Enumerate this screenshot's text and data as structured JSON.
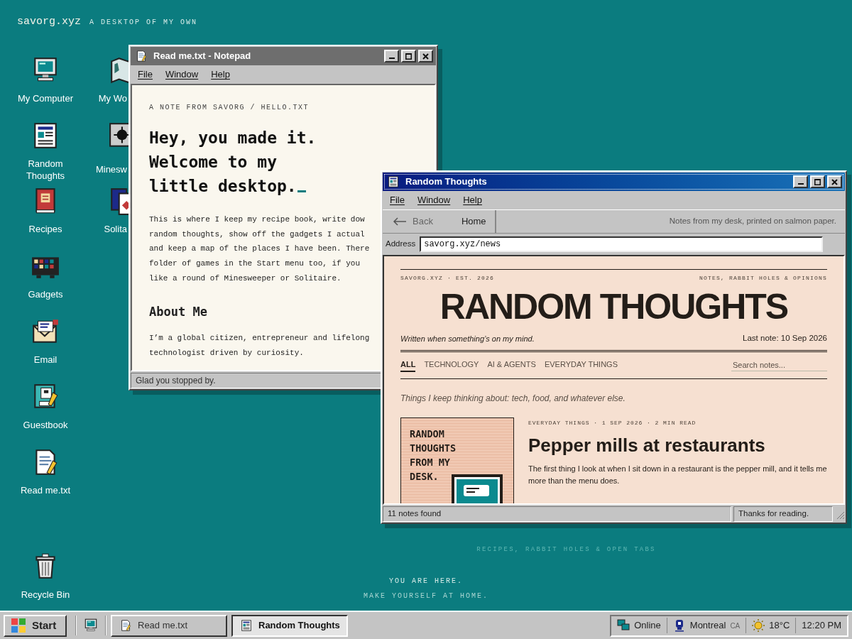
{
  "desktop": {
    "brand": "savorg.xyz",
    "tagline": "A DESKTOP OF MY OWN",
    "icons_column_1": [
      {
        "kind": "computer",
        "label": "My Computer"
      },
      {
        "kind": "newspaper",
        "label": "Random Thoughts"
      },
      {
        "kind": "book",
        "label": "Recipes"
      },
      {
        "kind": "gadgets",
        "label": "Gadgets"
      },
      {
        "kind": "email",
        "label": "Email"
      },
      {
        "kind": "guestbook",
        "label": "Guestbook"
      },
      {
        "kind": "textfile",
        "label": "Read me.txt"
      }
    ],
    "icons_column_2": [
      {
        "kind": "map",
        "label": "My Wo"
      },
      {
        "kind": "mine",
        "label": "Minesw"
      },
      {
        "kind": "cards",
        "label": "Solita"
      }
    ],
    "recycle_bin": {
      "kind": "bin",
      "label": "Recycle Bin"
    },
    "faint_tagline": "RECIPES, RABBIT HOLES & OPEN TABS",
    "footer_lines": [
      "YOU ARE HERE.",
      "MAKE YOURSELF AT HOME."
    ]
  },
  "notepad": {
    "title": "Read me.txt - Notepad",
    "active": false,
    "menu": [
      "File",
      "Window",
      "Help"
    ],
    "eyebrow": "A NOTE FROM SAVORG / HELLO.TXT",
    "heading_lines": [
      "Hey, you made it.",
      "Welcome to my",
      "little desktop."
    ],
    "paragraph_lines": [
      "This is where I keep my recipe book, write dow",
      "random thoughts, show off the gadgets I actual",
      "and keep a map of the places I have been. There",
      "folder of games in the Start menu too, if you",
      "like a round of Minesweeper or Solitaire."
    ],
    "section_heading": "About Me",
    "section_lines": [
      "I’m a global citizen, entrepreneur and lifelong",
      "technologist driven by curiosity."
    ],
    "status": "Glad you stopped by."
  },
  "browser": {
    "title": "Random Thoughts",
    "active": true,
    "menu": [
      "File",
      "Window",
      "Help"
    ],
    "back": "Back",
    "home": "Home",
    "toolbar_note": "Notes from my desk, printed on salmon paper.",
    "address_label": "Address",
    "address": "savorg.xyz/news",
    "page": {
      "masthead_left": "SAVORG.XYZ · EST. 2026",
      "masthead_right": "NOTES, RABBIT HOLES & OPINIONS",
      "name": "RANDOM THOUGHTS",
      "motto": "Written when something’s on my mind.",
      "last_note": "Last note: 10 Sep 2026",
      "categories": [
        {
          "label": "ALL",
          "selected": true
        },
        {
          "label": "TECHNOLOGY",
          "selected": false
        },
        {
          "label": "AI & AGENTS",
          "selected": false
        },
        {
          "label": "EVERYDAY THINGS",
          "selected": false
        }
      ],
      "search": {
        "placeholder": "Search notes..."
      },
      "intro": "Things I keep thinking about: tech, food, and whatever else.",
      "article": {
        "art_lines": [
          "RANDOM",
          "THOUGHTS",
          "FROM MY",
          "DESK."
        ],
        "meta": "EVERYDAY THINGS · 1 SEP 2026 · 2 MIN READ",
        "title": "Pepper mills at restaurants",
        "excerpt": "The first thing I look at when I sit down in a restaurant is the pepper mill, and it tells me more than the menu does."
      }
    },
    "status": [
      "11 notes found",
      "Thanks for reading."
    ]
  },
  "taskbar": {
    "start": "Start",
    "tasks": [
      {
        "kind": "textfile",
        "label": "Read me.txt",
        "selected": false
      },
      {
        "kind": "newspaper",
        "label": "Random Thoughts",
        "selected": true
      }
    ],
    "tray": [
      {
        "kind": "network",
        "label": "Online"
      },
      {
        "kind": "pin",
        "label": "Montreal",
        "suffix": "CA"
      },
      {
        "kind": "sun",
        "label": "18°C"
      },
      {
        "kind": "clock",
        "label": "12:20 PM"
      }
    ]
  }
}
